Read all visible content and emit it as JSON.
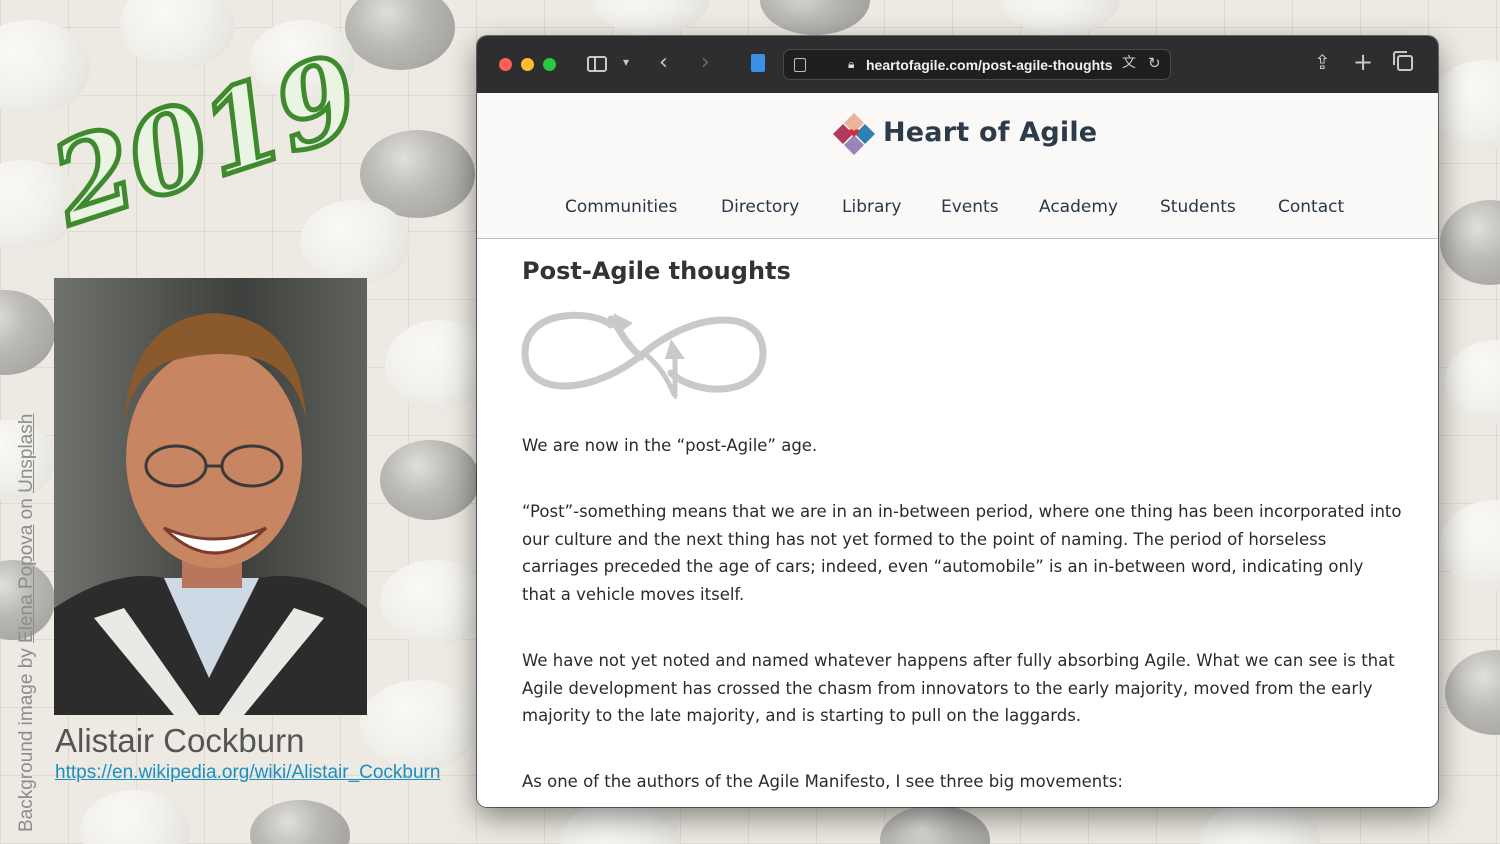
{
  "slide": {
    "year": "2019",
    "credit": {
      "prefix": "Background image  by ",
      "author": "Elena Popova",
      "mid": " on ",
      "site": "Unsplash"
    },
    "person": {
      "name": "Alistair Cockburn",
      "link": "https://en.wikipedia.org/wiki/Alistair_Cockburn"
    }
  },
  "browser": {
    "url": "heartofagile.com/post-agile-thoughts",
    "icons": {
      "sidebar": "sidebar-icon",
      "back": "chevron-left-icon",
      "forward": "chevron-right-icon",
      "share": "share-icon",
      "new_tab": "plus-icon",
      "tabs": "tab-overview-icon"
    }
  },
  "site": {
    "brand": "Heart of Agile",
    "nav": [
      "Communities",
      "Directory",
      "Library",
      "Events",
      "Academy",
      "Students",
      "Contact"
    ]
  },
  "post": {
    "title": "Post-Agile thoughts",
    "paragraphs": [
      "We are now in the “post-Agile” age.",
      "“Post”-something means that we are in an in-between period, where one thing has been incorporated into our culture and the next thing has not yet formed to the point of naming. The period of horseless carriages preceded the age of cars; indeed, even “automobile” is an in-between word, indicating only that a vehicle moves itself.",
      "We have not yet noted and named whatever happens after fully absorbing Agile. What we can see is that Agile development has crossed the chasm from innovators to the early majority, moved from the early majority to the late majority, and is starting to pull on the laggards.",
      "As one of the authors of the Agile Manifesto, I see three big movements:"
    ]
  },
  "colors": {
    "year_green": "#3f8a2e",
    "link_blue": "#1c8fc0",
    "nav_text": "#2a3848"
  }
}
